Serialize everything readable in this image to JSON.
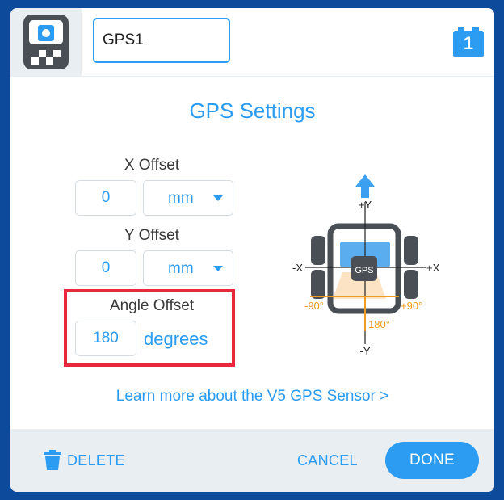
{
  "header": {
    "device_icon": "gps-sensor-icon",
    "name_value": "GPS1",
    "port_number": "1"
  },
  "title": "GPS Settings",
  "x_offset": {
    "label": "X Offset",
    "value": "0",
    "unit": "mm"
  },
  "y_offset": {
    "label": "Y Offset",
    "value": "0",
    "unit": "mm"
  },
  "angle_offset": {
    "label": "Angle Offset",
    "value": "180",
    "unit": "degrees"
  },
  "diagram": {
    "plus_y": "+Y",
    "minus_y": "-Y",
    "minus_x": "-X",
    "plus_x": "+X",
    "sensor_label": "GPS",
    "neg_90": "-90°",
    "pos_90": "+90°",
    "angle_180": "180°"
  },
  "learn_link": "Learn more about the V5 GPS Sensor >",
  "footer": {
    "delete_label": "DELETE",
    "cancel_label": "CANCEL",
    "done_label": "DONE"
  },
  "colors": {
    "accent": "#2b9cf2",
    "highlight": "#e8283c",
    "orange": "#f39a1e",
    "outer_background": "#0d4a9c"
  }
}
